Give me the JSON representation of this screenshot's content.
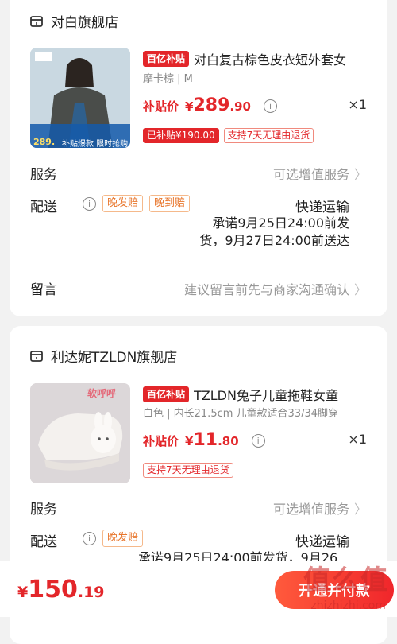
{
  "colors": {
    "accent": "#e3262a",
    "orange": "#e8762c",
    "muted": "#999999"
  },
  "stores": [
    {
      "name": "对白旗舰店",
      "subsidy_tag": "百亿补贴",
      "title": "对白复古棕色皮衣短外套女",
      "spec": "摩卡棕 | M",
      "price_label": "补贴价",
      "price_currency": "¥",
      "price_int": "289",
      "price_dec": ".90",
      "qty": "×1",
      "badges": [
        "已补贴¥190.00",
        "支持7天无理由退货"
      ],
      "thumb_price": "289.",
      "thumb_promo": "补贴爆款  限时抢购",
      "service_label": "服务",
      "service_value": "可选增值服务",
      "delivery_label": "配送",
      "delivery_tags": [
        "晚发赔",
        "晚到赔"
      ],
      "shipping": "快递运输",
      "promise_line1": "承诺9月25日24:00前发",
      "promise_line2": "货，9月27日24:00前送达",
      "note_label": "留言",
      "note_placeholder": "建议留言前先与商家沟通确认"
    },
    {
      "name": "利达妮TZLDN旗舰店",
      "subsidy_tag": "百亿补贴",
      "title": "TZLDN兔子儿童拖鞋女童",
      "spec": "白色 | 内长21.5cm 儿童款适合33/34脚穿",
      "price_label": "补贴价",
      "price_currency": "¥",
      "price_int": "11",
      "price_dec": ".80",
      "qty": "×1",
      "badges": [
        "支持7天无理由退货"
      ],
      "thumb_sticker": "软呼呼",
      "service_label": "服务",
      "service_value": "可选增值服务",
      "delivery_label": "配送",
      "delivery_tags": [
        "晚发赔"
      ],
      "shipping": "快递运输",
      "promise_line1": "承诺9月25日24:00前发货，9月26"
    }
  ],
  "footer": {
    "currency": "¥",
    "total_int": "150",
    "total_dec": ".19",
    "pay_button": "开通并付款"
  },
  "watermark": {
    "text": "值么值",
    "sub": "zhizhizhi.com"
  }
}
